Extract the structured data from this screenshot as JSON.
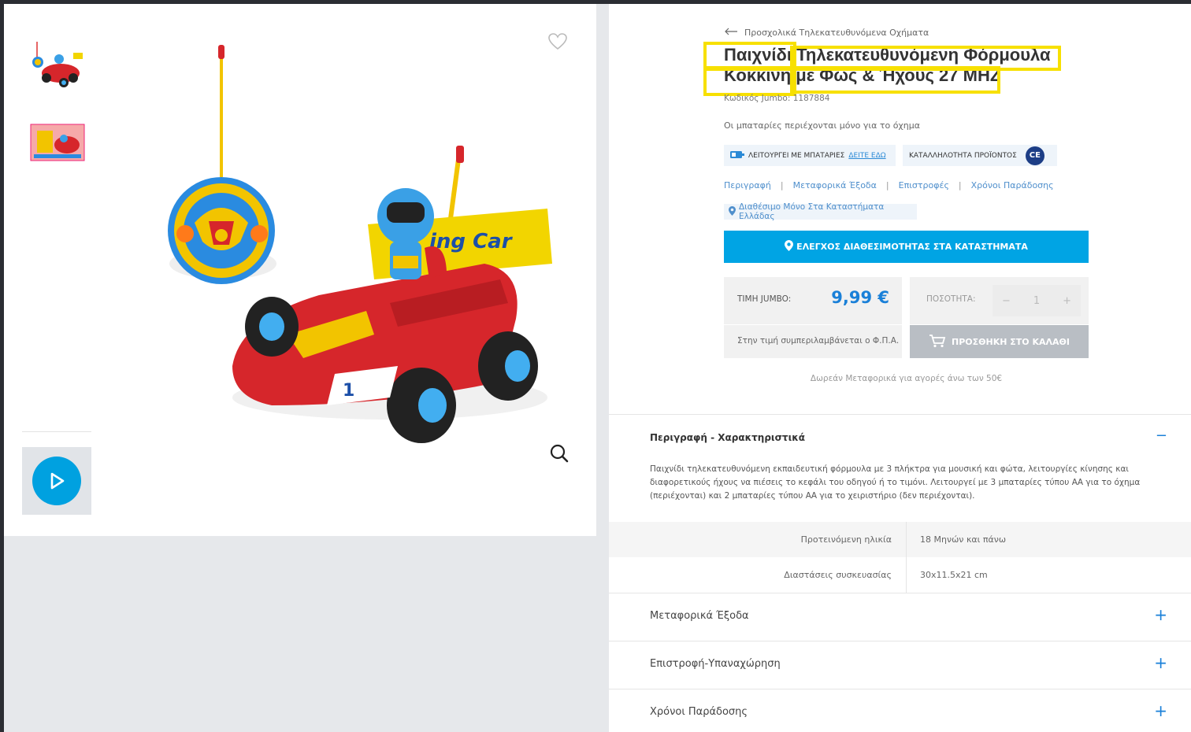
{
  "gallery": {
    "thumbnails": [
      "product-thumbnail-car",
      "product-thumbnail-box"
    ],
    "video_label": "play-video"
  },
  "product": {
    "breadcrumb": "Προσχολικά Τηλεκατευθυνόμενα Οχήματα",
    "title": "Παιχνίδι Τηλεκατευθυνόμενη Φόρμουλα Κόκκινη με Φως & Ήχους 27 MHZ",
    "sku": "Κωδικός Jumbo: 1187884",
    "battery_note": "Οι μπαταρίες περιέχονται μόνο για το όχημα",
    "badge_batteries": "ΛΕΙΤΟΥΡΓΕΙ ΜΕ ΜΠΑΤΑΡΙΕΣ",
    "badge_batteries_link": "ΔΕΙΤΕ ΕΔΩ",
    "badge_suitability": "ΚΑΤΑΛΛΗΛΟΤΗΤΑ ΠΡΟΪΟΝΤΟΣ",
    "ce_mark": "CE",
    "tabs": [
      "Περιγραφή",
      "Μεταφορικά Έξοδα",
      "Επιστροφές",
      "Χρόνοι Παράδοσης"
    ],
    "stores_only": "Διαθέσιμο Μόνο Στα Καταστήματα Ελλάδας",
    "check_availability": "ΕΛΕΓΧΟΣ ΔΙΑΘΕΣΙΜΟΤΗΤΑΣ ΣΤΑ ΚΑΤΑΣΤΗΜΑΤΑ",
    "price_label": "ΤΙΜΗ JUMBO:",
    "price": "9,99 €",
    "vat_note": "Στην τιμή συμπεριλαμβάνεται ο Φ.Π.Α.",
    "quantity_label": "ΠΟΣΟΤΗΤΑ:",
    "quantity": "1",
    "qty_minus": "−",
    "qty_plus": "+",
    "add_to_cart": "ΠΡΟΣΘΗΚΗ ΣΤΟ ΚΑΛΑΘΙ",
    "free_shipping": "Δωρεάν Μεταφορικά για αγορές άνω των 50€"
  },
  "description": {
    "heading": "Περιγραφή - Χαρακτηριστικά",
    "toggle": "−",
    "body": "Παιχνίδι τηλεκατευθυνόμενη εκπαιδευτική φόρμουλα με 3 πλήκτρα για μουσική και φώτα, λειτουργίες κίνησης και διαφορετικούς ήχους να πιέσεις το κεφάλι του οδηγού ή το τιμόνι. Λειτουργεί με 3 μπαταρίες τύπου ΑΑ για το όχημα (περιέχονται) και 2 μπαταρίες τύπου ΑΑ για το χειριστήριο (δεν περιέχονται).",
    "specs": [
      {
        "key": "Προτεινόμενη ηλικία",
        "value": "18 Μηνών και πάνω"
      },
      {
        "key": "Διαστάσεις συσκευασίας",
        "value": "30x11.5x21 cm"
      }
    ]
  },
  "accordions": [
    {
      "label": "Μεταφορικά Έξοδα",
      "toggle": "+"
    },
    {
      "label": "Επιστροφή-Υπαναχώρηση",
      "toggle": "+"
    },
    {
      "label": "Χρόνοι Παράδοσης",
      "toggle": "+"
    }
  ],
  "colors": {
    "accent_blue": "#00a4e4",
    "price_blue": "#1a80d8",
    "highlight_yellow": "#f7e000",
    "car_red": "#d6262b"
  }
}
